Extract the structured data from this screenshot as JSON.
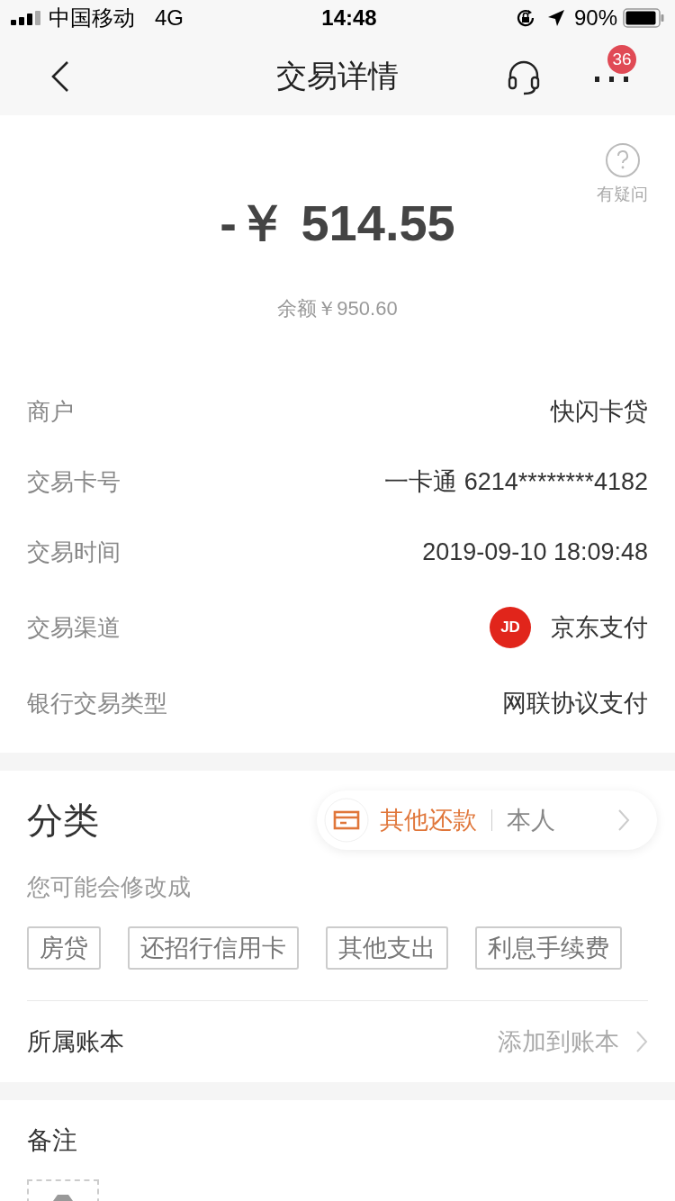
{
  "status_bar": {
    "carrier": "中国移动",
    "network": "4G",
    "time": "14:48",
    "battery_text": "90%"
  },
  "nav": {
    "title": "交易详情",
    "badge": "36"
  },
  "summary": {
    "amount": "-￥ 514.55",
    "balance": "余额￥950.60",
    "help_label": "有疑问"
  },
  "details": [
    {
      "kind": "text",
      "label": "商户",
      "value": "快闪卡贷"
    },
    {
      "kind": "text",
      "label": "交易卡号",
      "value": "一卡通 6214********4182"
    },
    {
      "kind": "text",
      "label": "交易时间",
      "value": "2019-09-10 18:09:48"
    },
    {
      "kind": "channel",
      "label": "交易渠道",
      "value": "京东支付",
      "logo_text": "JD"
    },
    {
      "kind": "text",
      "label": "银行交易类型",
      "value": "网联协议支付"
    }
  ],
  "category": {
    "title": "分类",
    "chosen": "其他还款",
    "person": "本人",
    "hint": "您可能会修改成",
    "suggestions": [
      "房贷",
      "还招行信用卡",
      "其他支出",
      "利息手续费"
    ]
  },
  "ledger": {
    "label": "所属账本",
    "action": "添加到账本"
  },
  "note": {
    "title": "备注"
  }
}
